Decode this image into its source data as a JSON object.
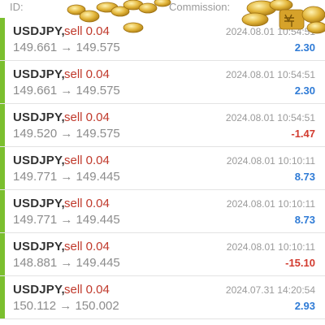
{
  "header": {
    "id_label": "ID:",
    "commission_label": "Commission:"
  },
  "decoration": {
    "coins_color": "#e2b53a",
    "icon": "gold-coins-icon"
  },
  "colors": {
    "accent_bar": "#7bbf2e",
    "sell": "#c0392b",
    "profit": "#2f7bd6",
    "loss": "#d23b2f"
  },
  "trades": [
    {
      "symbol": "USDJPY,",
      "side": "sell 0.04",
      "prices": "149.661 → 149.575",
      "time": "2024.08.01 10:54:51",
      "pl": "2.30",
      "pl_sign": "pos"
    },
    {
      "symbol": "USDJPY,",
      "side": "sell 0.04",
      "prices": "149.661 → 149.575",
      "time": "2024.08.01 10:54:51",
      "pl": "2.30",
      "pl_sign": "pos"
    },
    {
      "symbol": "USDJPY,",
      "side": "sell 0.04",
      "prices": "149.520 → 149.575",
      "time": "2024.08.01 10:54:51",
      "pl": "-1.47",
      "pl_sign": "neg"
    },
    {
      "symbol": "USDJPY,",
      "side": "sell 0.04",
      "prices": "149.771 → 149.445",
      "time": "2024.08.01 10:10:11",
      "pl": "8.73",
      "pl_sign": "pos"
    },
    {
      "symbol": "USDJPY,",
      "side": "sell 0.04",
      "prices": "149.771 → 149.445",
      "time": "2024.08.01 10:10:11",
      "pl": "8.73",
      "pl_sign": "pos"
    },
    {
      "symbol": "USDJPY,",
      "side": "sell 0.04",
      "prices": "148.881 → 149.445",
      "time": "2024.08.01 10:10:11",
      "pl": "-15.10",
      "pl_sign": "neg"
    },
    {
      "symbol": "USDJPY,",
      "side": "sell 0.04",
      "prices": "150.112 → 150.002",
      "time": "2024.07.31 14:20:54",
      "pl": "2.93",
      "pl_sign": "pos"
    }
  ]
}
